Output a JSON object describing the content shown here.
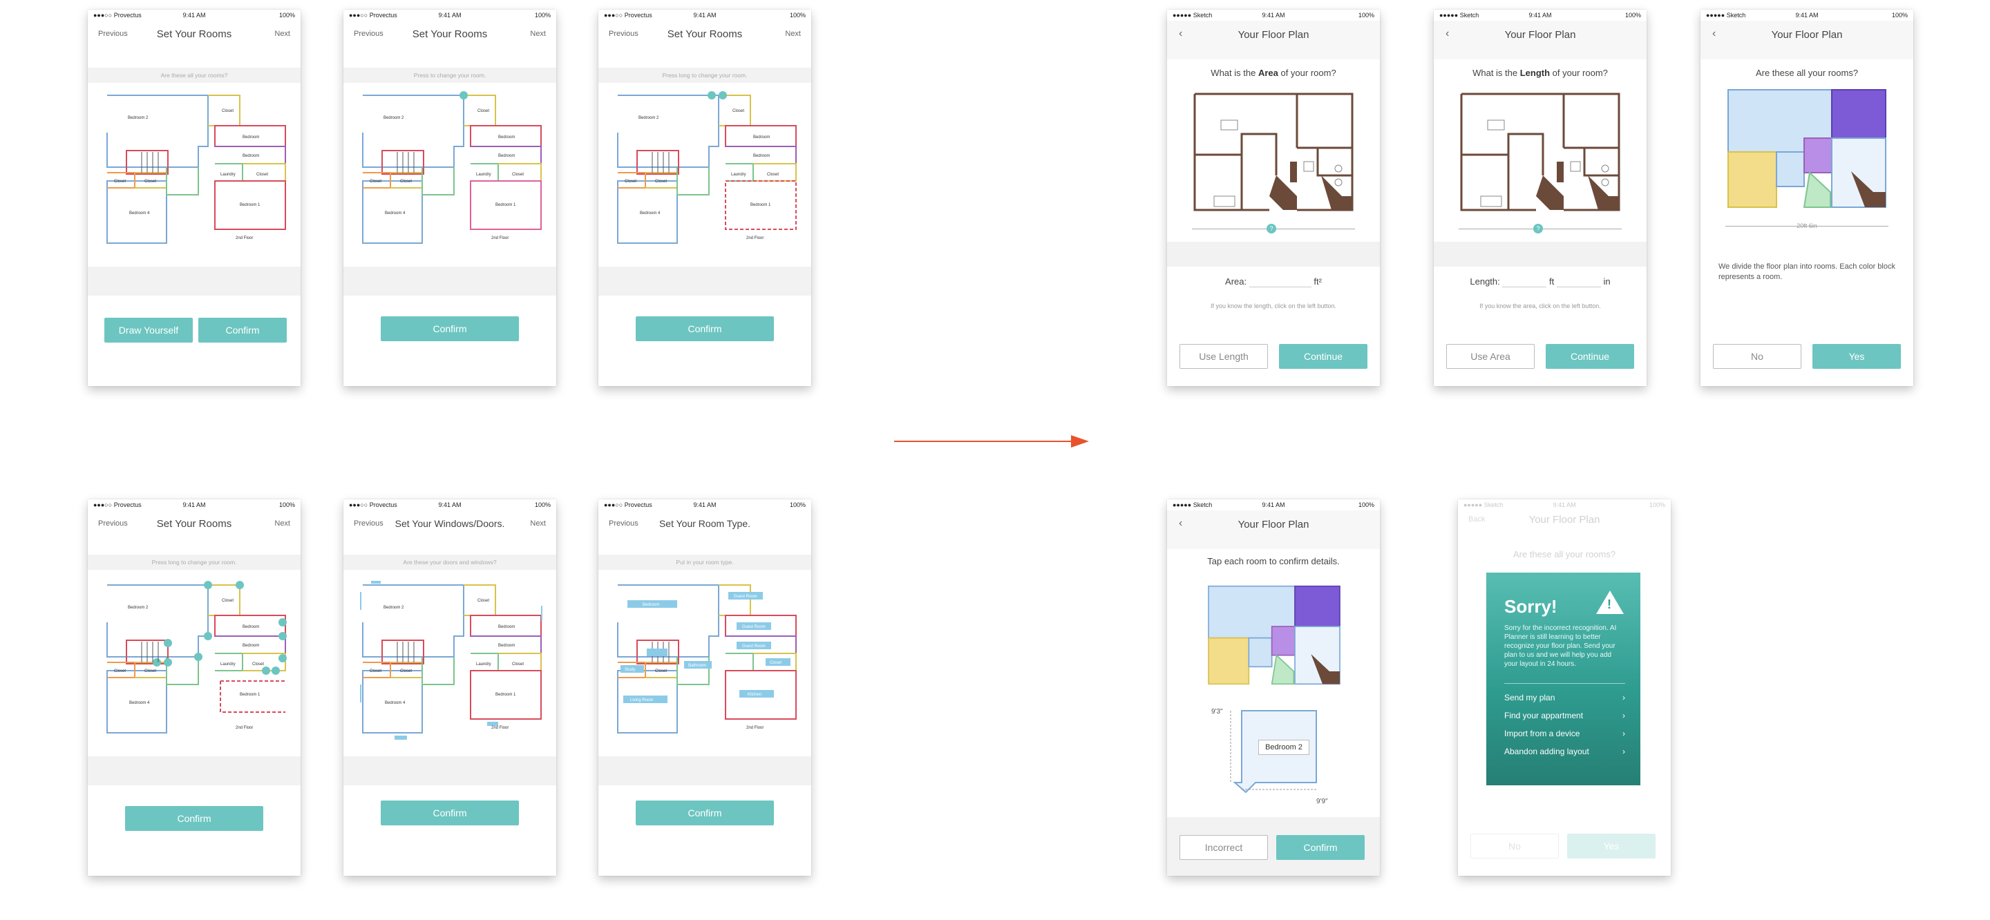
{
  "colors": {
    "accent": "#6cc5c1",
    "arrow": "#e8532c",
    "wall_blue": "#7aa7d6",
    "wall_red": "#d94a5a",
    "wall_yellow": "#d8c24b",
    "wall_purple": "#9a5fb8",
    "wall_green": "#7cc58d",
    "wall_orange": "#f09a4a",
    "wall_pink": "#e0609a",
    "fill_blue": "#cfe4f7",
    "fill_purple": "#7d5bd6",
    "fill_yellow": "#f3dc8a"
  },
  "status": {
    "carrier_provectus": "Provectus",
    "carrier_sketch": "Sketch",
    "time": "9:41 AM",
    "battery": "100%"
  },
  "screens": {
    "s1": {
      "left": "Previous",
      "title": "Set Your Rooms",
      "right": "Next",
      "hint": "Are these all your rooms?",
      "btn1": "Draw Yourself",
      "btn2": "Confirm"
    },
    "s2": {
      "left": "Previous",
      "title": "Set Your Rooms",
      "right": "Next",
      "hint": "Press to change your room.",
      "btn": "Confirm"
    },
    "s3": {
      "left": "Previous",
      "title": "Set Your Rooms",
      "right": "Next",
      "hint": "Press long to change your room.",
      "btn": "Confirm"
    },
    "s4": {
      "left": "Previous",
      "title": "Set Your Rooms",
      "right": "Next",
      "hint": "Press long to change your room.",
      "btn": "Confirm"
    },
    "s5": {
      "left": "Previous",
      "title": "Set Your Windows/Doors.",
      "right": "Next",
      "hint": "Are these your doors and windows?",
      "btn": "Confirm"
    },
    "s6": {
      "left": "Previous",
      "title": "Set Your Room Type.",
      "hint": "Put in your room type.",
      "btn": "Confirm",
      "labels": [
        "Bedroom",
        "Guest Room",
        "Guest Room",
        "Guest Room",
        "Closet",
        "Study",
        "Bathroom",
        "Living Room",
        "Kitchen"
      ]
    },
    "s7": {
      "title": "Your Floor Plan",
      "q_pre": "What is the ",
      "q_bold": "Area",
      "q_post": " of your room?",
      "marker": "?",
      "input_label": "Area:",
      "unit": "ft²",
      "hint": "If you know the length, click on the left button.",
      "btn1": "Use Length",
      "btn2": "Continue"
    },
    "s8": {
      "title": "Your Floor Plan",
      "q_pre": "What is the ",
      "q_bold": "Length",
      "q_post": " of your room?",
      "marker": "?",
      "input_label": "Length:",
      "unit1": "ft",
      "unit2": "in",
      "hint": "If you know the area, click on the left button.",
      "btn1": "Use Area",
      "btn2": "Continue"
    },
    "s9": {
      "title": "Your Floor Plan",
      "q": "Are these all your rooms?",
      "scale": "20ft 6in",
      "desc": "We divide the floor plan into rooms. Each color block represents a room.",
      "btn1": "No",
      "btn2": "Yes"
    },
    "s10": {
      "title": "Your Floor Plan",
      "q": "Tap each room to confirm details.",
      "room": "Bedroom 2",
      "dim1": "9'3\"",
      "dim2": "9'9\"",
      "btn1": "Incorrect",
      "btn2": "Confirm"
    },
    "s11": {
      "back": "Back",
      "title": "Your Floor Plan",
      "q": "Are these all your rooms?",
      "heading": "Sorry!",
      "warn": "!",
      "body": "Sorry for the incorrect recognition. AI Planner is still learning to better recognize your floor plan. Send your plan to us and we will help you add your layout in 24 hours.",
      "items": [
        "Send my plan",
        "Find your appartment",
        "Import from a device",
        "Abandon adding layout"
      ],
      "chev": "›",
      "btn1": "No",
      "btn2": "Yes"
    }
  },
  "plan_labels": {
    "bedroom2": "Bedroom 2",
    "closet": "Closet",
    "bedroom": "Bedroom",
    "laundry": "Laundry",
    "bedroom4": "Bedroom 4",
    "bedroom1": "Bedroom 1",
    "floor": "2nd Floor"
  }
}
